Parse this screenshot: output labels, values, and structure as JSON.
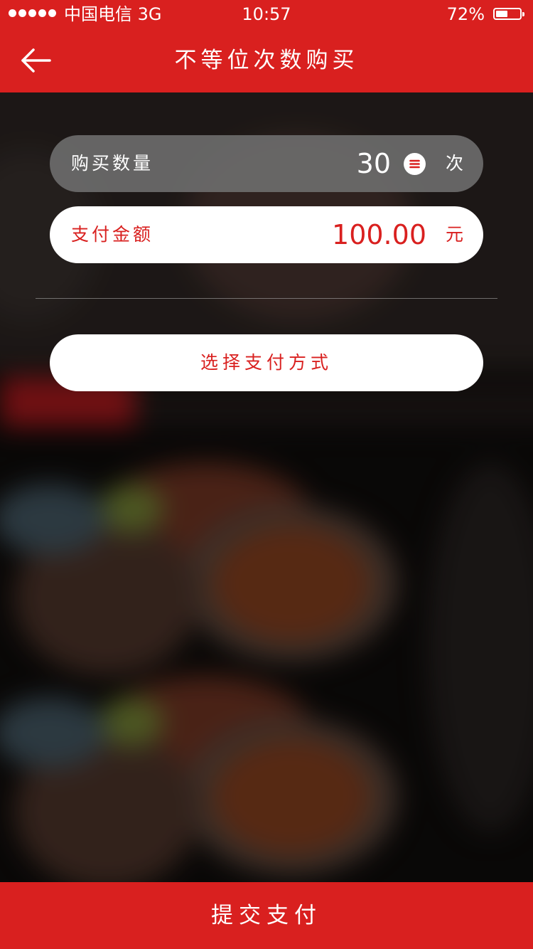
{
  "status_bar": {
    "carrier": "中国电信",
    "network": "3G",
    "time": "10:57",
    "battery_percent": "72%",
    "battery_level": 0.5
  },
  "nav": {
    "title": "不等位次数购买",
    "back_icon": "arrow-left-icon"
  },
  "form": {
    "quantity": {
      "label": "购买数量",
      "value": "30",
      "unit": "次",
      "picker_icon": "list-menu-icon"
    },
    "amount": {
      "label": "支付金额",
      "value": "100.00",
      "unit": "元"
    }
  },
  "actions": {
    "select_payment_label": "选择支付方式",
    "submit_label": "提交支付"
  },
  "colors": {
    "brand_red": "#d9201f",
    "pill_gray": "#707070",
    "white": "#ffffff"
  }
}
